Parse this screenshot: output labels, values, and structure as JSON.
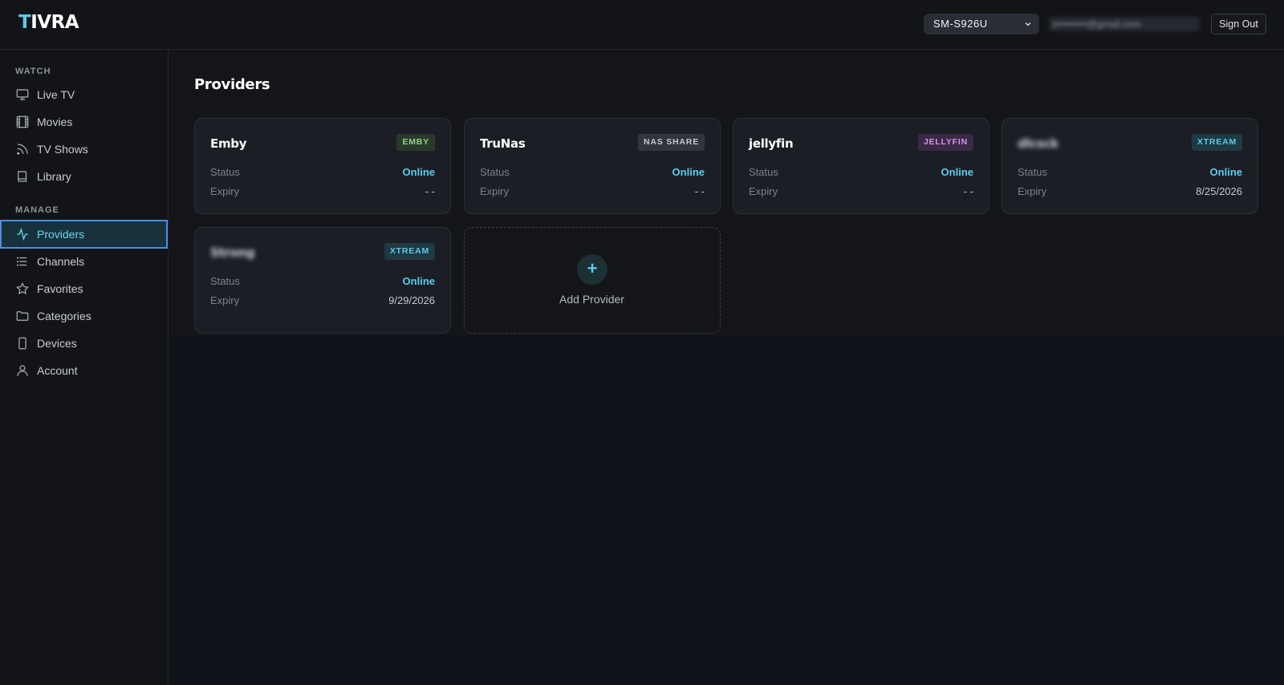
{
  "header": {
    "logo_first": "T",
    "logo_rest": "IVRA",
    "device_selected": "SM-S926U",
    "email": "s•••••••••@gmail.com",
    "signout_label": "Sign Out"
  },
  "sidebar": {
    "watch_label": "WATCH",
    "manage_label": "MANAGE",
    "watch_items": [
      {
        "label": "Live TV",
        "icon": "monitor-icon"
      },
      {
        "label": "Movies",
        "icon": "film-icon"
      },
      {
        "label": "TV Shows",
        "icon": "rss-icon"
      },
      {
        "label": "Library",
        "icon": "book-icon"
      }
    ],
    "manage_items": [
      {
        "label": "Providers",
        "icon": "activity-icon",
        "active": true
      },
      {
        "label": "Channels",
        "icon": "list-icon"
      },
      {
        "label": "Favorites",
        "icon": "star-icon"
      },
      {
        "label": "Categories",
        "icon": "folder-icon"
      },
      {
        "label": "Devices",
        "icon": "phone-icon"
      },
      {
        "label": "Account",
        "icon": "user-icon"
      }
    ]
  },
  "main": {
    "title": "Providers",
    "status_label": "Status",
    "expiry_label": "Expiry",
    "providers": [
      {
        "name": "Emby",
        "badge": "EMBY",
        "status": "Online",
        "expiry": "- -",
        "badge_bg": "#2a3a2a",
        "badge_fg": "#8fd18a"
      },
      {
        "name": "TruNas",
        "badge": "NAS SHARE",
        "status": "Online",
        "expiry": "- -",
        "badge_bg": "#32353c",
        "badge_fg": "#c3c7ce"
      },
      {
        "name": "jellyfin",
        "badge": "JELLYFIN",
        "status": "Online",
        "expiry": "- -",
        "badge_bg": "#3a2a45",
        "badge_fg": "#d592f0"
      },
      {
        "name": "dlcsck",
        "badge": "XTREAM",
        "status": "Online",
        "expiry": "8/25/2026",
        "badge_bg": "#1e3a43",
        "badge_fg": "#5ec8ea"
      },
      {
        "name": "Strong",
        "badge": "XTREAM",
        "status": "Online",
        "expiry": "9/29/2026",
        "badge_bg": "#1e3a43",
        "badge_fg": "#5ec8ea"
      }
    ],
    "add_label": "Add Provider",
    "add_symbol": "+"
  },
  "colors": {
    "accent": "#5ec8ea",
    "active_border": "#4d8de0"
  }
}
